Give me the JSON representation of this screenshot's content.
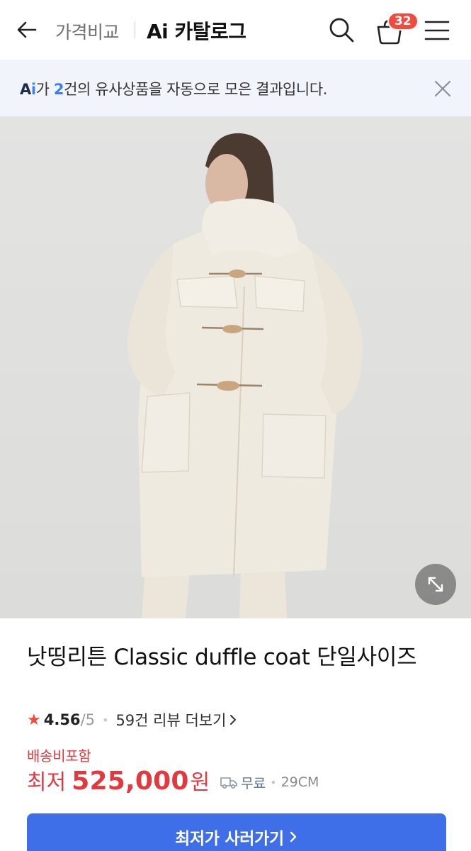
{
  "header": {
    "crumb_compare": "가격비교",
    "crumb_title": "Ai 카탈로그",
    "cart_count": "32",
    "icons": {
      "back": "arrow-left-icon",
      "search": "search-icon",
      "cart": "cart-icon",
      "menu": "hamburger-menu-icon"
    }
  },
  "notice": {
    "ai_label_a": "A",
    "ai_label_i": "i",
    "text_ga": "가 ",
    "count": "2",
    "text_rest": "건의 유사상품을 자동으로 모은 결과입니다.",
    "close_icon": "close-icon"
  },
  "product": {
    "image_desc": "product-photo",
    "title": "낫띵리튼 Classic duffle coat 단일사이즈",
    "rating": "4.56",
    "rating_max": "/5",
    "review_text": "59건 리뷰 더보기",
    "shipping_note": "배송비포함",
    "price_label": "최저",
    "price_value": "525,000",
    "price_unit": "원",
    "shipping_fee": "무료",
    "store": "29CM",
    "cta_label": "최저가 사러가기"
  },
  "colors": {
    "accent": "#3f6fe8",
    "price_red": "#e2393f",
    "badge_red": "#ef4b3f",
    "notice_bg": "#f1f5fb"
  }
}
